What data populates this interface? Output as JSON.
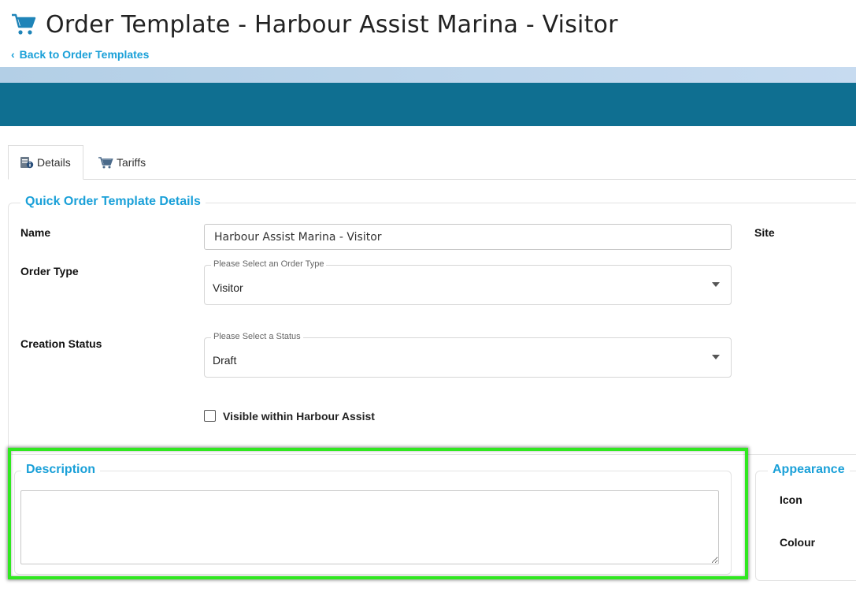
{
  "header": {
    "title": "Order Template - Harbour Assist Marina - Visitor",
    "back_link": "Back to Order Templates",
    "icon": "shopping-cart-icon"
  },
  "tabs": [
    {
      "label": "Details",
      "icon": "details-info-icon",
      "active": true
    },
    {
      "label": "Tariffs",
      "icon": "shopping-cart-icon",
      "active": false
    }
  ],
  "details": {
    "legend": "Quick Order Template Details",
    "name_label": "Name",
    "name_value": "Harbour Assist Marina - Visitor",
    "site_label": "Site",
    "order_type_label": "Order Type",
    "order_type_placeholder": "Please Select an Order Type",
    "order_type_value": "Visitor",
    "status_label": "Creation Status",
    "status_placeholder": "Please Select a Status",
    "status_value": "Draft",
    "visible_label": "Visible within Harbour Assist",
    "visible_checked": false
  },
  "description": {
    "legend": "Description",
    "value": ""
  },
  "appearance": {
    "legend": "Appearance",
    "icon_label": "Icon",
    "colour_label": "Colour"
  },
  "colors": {
    "accent": "#1aa0d8",
    "band": "#0f6f91",
    "highlight": "#2fe81f"
  }
}
